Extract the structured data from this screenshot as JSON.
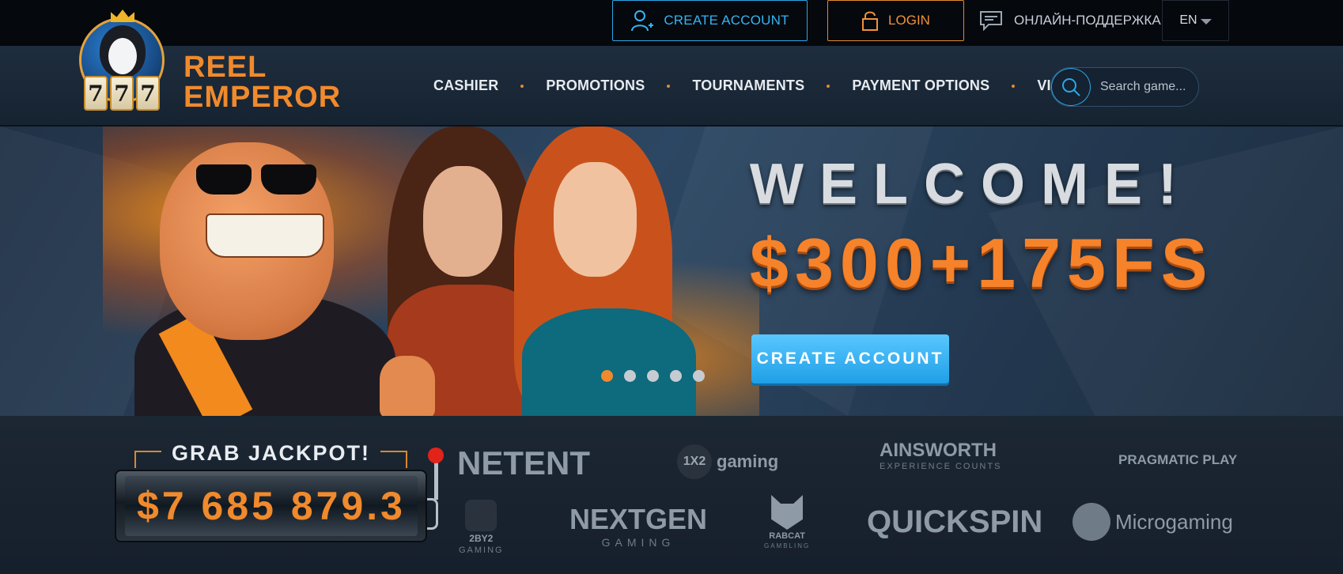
{
  "topbar": {
    "create_account": "CREATE ACCOUNT",
    "login": "LOGIN",
    "support": "ОНЛАЙН-ПОДДЕРЖКА",
    "language": "EN"
  },
  "brand": {
    "line1": "REEL",
    "line2": "EMPEROR",
    "seven_digits": [
      "7",
      "7",
      "7"
    ]
  },
  "nav": {
    "items": [
      "CASHIER",
      "PROMOTIONS",
      "TOURNAMENTS",
      "PAYMENT OPTIONS",
      "VIP"
    ]
  },
  "search": {
    "placeholder": "Search game..."
  },
  "banner": {
    "headline": "WELCOME!",
    "bonus": "$300+175FS",
    "cta": "CREATE ACCOUNT",
    "slides_total": 5,
    "active_slide": 1
  },
  "jackpot": {
    "label": "GRAB JACKPOT!",
    "amount": "$7 685 879.3"
  },
  "providers": {
    "netent": "NETENT",
    "gaming1x2": "gaming",
    "gaming1x2_mark": "1X2",
    "ainsworth": "AINSWORTH",
    "ainsworth_tag": "EXPERIENCE COUNTS",
    "pragmatic": "PRAGMATIC PLAY",
    "twobytwo": "2BY2",
    "twobytwo_tag": "GAMING",
    "nextgen": "NEXTGEN",
    "nextgen_tag": "GAMING",
    "rabcat": "RABCAT",
    "rabcat_tag": "GAMBLING",
    "quickspin": "QUICKSPIN",
    "microgaming": "Microgaming"
  },
  "colors": {
    "accent_orange": "#f08a2c",
    "accent_blue": "#2aa7e6",
    "background_dark": "#05080d"
  }
}
